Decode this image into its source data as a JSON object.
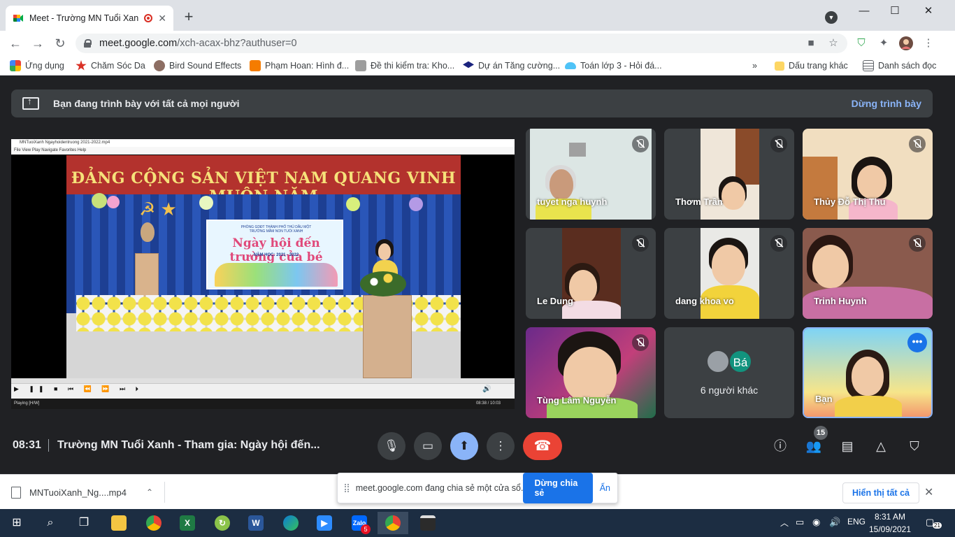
{
  "browser": {
    "tab_title": "Meet - Trường MN Tuổi Xanh",
    "url_host": "meet.google.com",
    "url_path": "/xch-acax-bhz?authuser=0",
    "bookmarks": [
      {
        "label": "Ứng dụng",
        "color": "#4285f4"
      },
      {
        "label": "Chăm Sóc Da",
        "color": "#d93025"
      },
      {
        "label": "Bird Sound Effects",
        "color": "#8d6e63"
      },
      {
        "label": "Phạm Hoan: Hình đ...",
        "color": "#f57c00"
      },
      {
        "label": "Đề thi kiểm tra: Kho...",
        "color": "#9e9e9e"
      },
      {
        "label": "Dự án Tăng cường...",
        "color": "#1a237e"
      },
      {
        "label": "Toán lớp 3 - Hỏi đá...",
        "color": "#4fc3f7"
      },
      {
        "label": "Dấu trang khác",
        "color": "#fdd663"
      },
      {
        "label": "Danh sách đọc",
        "color": "#5f6368"
      }
    ]
  },
  "meet": {
    "banner_text": "Bạn đang trình bày với tất cả mọi người",
    "stop_presenting": "Dừng trình bày",
    "video": {
      "player_title": "MNTuoiXanh Ngayhoidentruong 2021-2022.mp4",
      "player_menu": "File    View    Play    Navigate    Favorites    Help",
      "slogan": "ĐẢNG CỘNG SẢN VIỆT NAM QUANG VINH MUÔN NĂM",
      "poster_header": "PHÒNG GDĐT THÀNH PHỐ THỦ DẦU MỘT\nTRƯỜNG MẦM NON TUỔI XANH",
      "poster_title": "Ngày hội đến trường của bé",
      "poster_year": "NĂM HỌC: 2021 - 2022",
      "status": "Playing [H/W]",
      "time": "08:38 / 10:03"
    },
    "participants": [
      {
        "name": "tuyet nga huynh",
        "muted": true
      },
      {
        "name": "Thơm Trần",
        "muted": true
      },
      {
        "name": "Thủy Đỗ Thị Thu",
        "muted": true
      },
      {
        "name": "Le Dung",
        "muted": true
      },
      {
        "name": "dang khoa vo",
        "muted": true
      },
      {
        "name": "Trinh Huynh",
        "muted": true
      },
      {
        "name": "Tùng Lâm Nguyễn",
        "muted": true
      },
      {
        "name": "Bạn",
        "muted": false
      }
    ],
    "others_label": "6 người khác",
    "others_avatar": "Bá",
    "clock": "08:31",
    "meeting_name": "Trường MN Tuổi Xanh - Tham gia: Ngày hội đến...",
    "people_count": "15"
  },
  "download": {
    "filename": "MNTuoiXanh_Ng....mp4",
    "show_all": "Hiển thị tất cả"
  },
  "share_popup": {
    "text": "meet.google.com đang chia sẻ một cửa sổ.",
    "share_button": "Dừng chia sẻ",
    "hide_button": "Ẩn"
  },
  "taskbar": {
    "language": "ENG",
    "time": "8:31 AM",
    "date": "15/09/2021",
    "zalo_badge": "5",
    "notifications": "21"
  }
}
